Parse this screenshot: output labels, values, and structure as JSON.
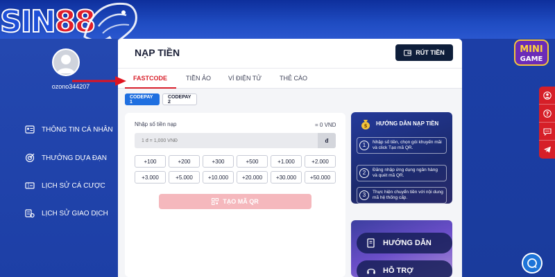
{
  "brand": {
    "logo_left": "SIN",
    "logo_right": "88"
  },
  "user": {
    "username": "ozono344207"
  },
  "sidebar": {
    "items": [
      {
        "label": "THÔNG TIN CÁ NHÂN",
        "icon": "id-card-icon"
      },
      {
        "label": "THƯỞNG DỰA ĐẠN",
        "icon": "bullseye-icon"
      },
      {
        "label": "LỊCH SỬ CÁ CƯỢC",
        "icon": "ticket-icon"
      },
      {
        "label": "LỊCH SỬ GIAO DỊCH",
        "icon": "transaction-icon"
      }
    ]
  },
  "header": {
    "title": "NẠP TIỀN",
    "withdraw_label": "RÚT TIỀN"
  },
  "tabs": [
    {
      "label": "FASTCODE",
      "active": true
    },
    {
      "label": "TIỀN ẢO",
      "active": false
    },
    {
      "label": "VÍ ĐIỆN TỬ",
      "active": false
    },
    {
      "label": "THẺ CÀO",
      "active": false
    }
  ],
  "subtabs": [
    {
      "label": "CODEPAY 1",
      "active": true
    },
    {
      "label": "CODEPAY 2",
      "active": false
    }
  ],
  "deposit": {
    "amount_label": "Nhập số tiền nạp",
    "amount_value": "= 0 VND",
    "input_placeholder": "1 đ = 1,000 VNĐ",
    "unit": "đ",
    "quick_amounts": [
      "+100",
      "+200",
      "+300",
      "+500",
      "+1.000",
      "+2.000",
      "+3.000",
      "+5.000",
      "+10.000",
      "+20.000",
      "+30.000",
      "+50.000"
    ],
    "create_qr_label": "TẠO MÃ QR"
  },
  "guide": {
    "title": "HƯỚNG DẪN NẠP TIỀN",
    "steps": [
      {
        "num": "1",
        "text": "Nhập số tiền, chọn gói khuyến mãi và click Tạo mã QR."
      },
      {
        "num": "2",
        "text": "Đăng nhập ứng dụng ngân hàng và quét mã QR."
      },
      {
        "num": "3",
        "text": "Thực hiện chuyển tiền với nội dung mã hệ thống cấp."
      }
    ]
  },
  "support": {
    "guide_label": "HƯỚNG DẪN",
    "help_label": "HỖ TRỢ"
  },
  "mini_game": {
    "line1": "MINI",
    "line2": "GAME"
  },
  "colors": {
    "accent_red": "#d81f2a",
    "primary_blue": "#1f6fe0",
    "dark_navy": "#0e1e3a"
  }
}
